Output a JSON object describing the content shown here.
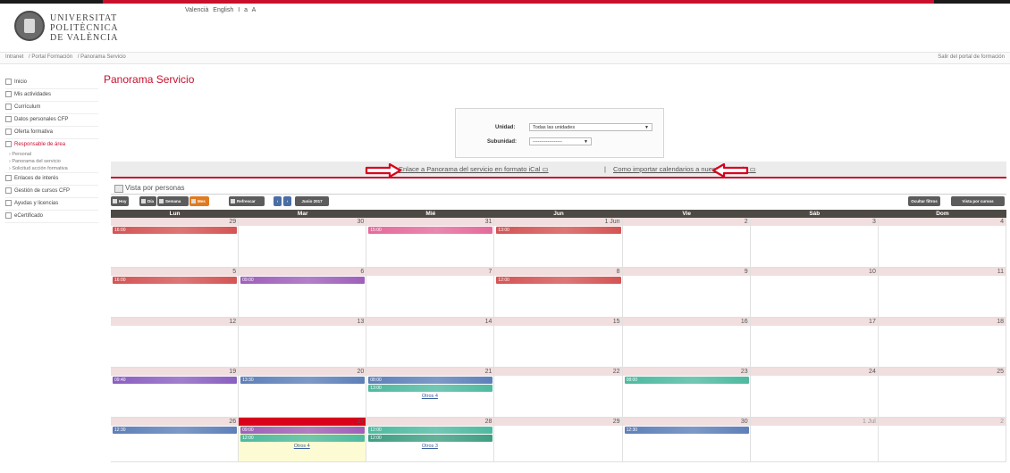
{
  "header": {
    "logo": {
      "line1": "UNIVERSITAT",
      "line2": "POLITÈCNICA",
      "line3": "DE VALÈNCIA"
    },
    "languages": [
      "Valencià",
      "English",
      "I",
      "a",
      "A"
    ]
  },
  "breadcrumb": {
    "items": [
      "Intranet",
      "/ Portal Formación",
      "/ Panorama Servicio"
    ],
    "exit": "Salir del portal de formación"
  },
  "page_title": "Panorama Servicio",
  "sidebar": {
    "items": [
      {
        "label": "Inicio",
        "active": false
      },
      {
        "label": "Mis actividades",
        "active": false
      },
      {
        "label": "Currículum",
        "active": false
      },
      {
        "label": "Datos personales CFP",
        "active": false
      },
      {
        "label": "Oferta formativa",
        "active": false
      },
      {
        "label": "Responsable de área",
        "active": true
      },
      {
        "label": "Enlaces de interés",
        "active": false
      },
      {
        "label": "Gestión de cursos CFP",
        "active": false
      },
      {
        "label": "Ayudas y licencias",
        "active": false
      },
      {
        "label": "eCertificado",
        "active": false
      }
    ],
    "subitems": [
      "› Personal",
      "› Panorama del servicio",
      "› Solicitud acción formativa"
    ]
  },
  "filters": {
    "unidad_label": "Unidad:",
    "unidad_value": "Todas las unidades",
    "subunidad_label": "Subunidad:",
    "subunidad_value": "------------------"
  },
  "links": {
    "ical": "Enlace a Panorama del servicio en formato iCal",
    "separator": "|",
    "import": "Como importar calendarios a nuestra agenda"
  },
  "vista": {
    "title": "Vista por personas"
  },
  "toolbar": {
    "hoy": "Hoy",
    "dia": "Día",
    "semana": "Semana",
    "mes": "Mes",
    "refrescar": "Refrescar",
    "prev": "‹",
    "next": "›",
    "period": "Junio 2017",
    "ocultar": "Ocultar filtros",
    "vista_cursos": "Vista por cursos"
  },
  "calendar": {
    "days": [
      "Lun",
      "Mar",
      "Mié",
      "Jun",
      "Vie",
      "Sáb",
      "Dom"
    ],
    "weeks": [
      [
        "29",
        "30",
        "31",
        "1 Jun",
        "2",
        "3",
        "4"
      ],
      [
        "5",
        "6",
        "7",
        "8",
        "9",
        "10",
        "11"
      ],
      [
        "12",
        "13",
        "14",
        "15",
        "16",
        "17",
        "18"
      ],
      [
        "19",
        "20",
        "21",
        "22",
        "23",
        "24",
        "25"
      ],
      [
        "26",
        "27",
        "28",
        "29",
        "30",
        "1 Jul",
        "2"
      ]
    ],
    "events": [
      {
        "week": 0,
        "day": 0,
        "slot": 0,
        "time": "16:00",
        "color": "#d45454"
      },
      {
        "week": 0,
        "day": 2,
        "slot": 0,
        "time": "15:00",
        "color": "#e46a9a"
      },
      {
        "week": 0,
        "day": 3,
        "slot": 0,
        "time": "13:00",
        "color": "#d45454"
      },
      {
        "week": 1,
        "day": 0,
        "slot": 0,
        "time": "16:00",
        "color": "#d45454"
      },
      {
        "week": 1,
        "day": 1,
        "slot": 0,
        "time": "09:00",
        "color": "#9e5fba"
      },
      {
        "week": 1,
        "day": 3,
        "slot": 0,
        "time": "12:00",
        "color": "#d45454"
      },
      {
        "week": 3,
        "day": 0,
        "slot": 0,
        "time": "09:40",
        "color": "#8a5fc0"
      },
      {
        "week": 3,
        "day": 1,
        "slot": 0,
        "time": "13:30",
        "color": "#5e7fb8"
      },
      {
        "week": 3,
        "day": 2,
        "slot": 0,
        "time": "08:00",
        "color": "#5e7fb8"
      },
      {
        "week": 3,
        "day": 2,
        "slot": 1,
        "time": "13:00",
        "color": "#4fb9a0"
      },
      {
        "week": 3,
        "day": 4,
        "slot": 0,
        "time": "08:00",
        "color": "#4fb9a0"
      },
      {
        "week": 4,
        "day": 0,
        "slot": 0,
        "time": "12:30",
        "color": "#5e7fb8"
      },
      {
        "week": 4,
        "day": 1,
        "slot": 0,
        "time": "09:00",
        "color": "#9e5fba"
      },
      {
        "week": 4,
        "day": 1,
        "slot": 1,
        "time": "12:00",
        "color": "#4fb9a0"
      },
      {
        "week": 4,
        "day": 2,
        "slot": 0,
        "time": "12:00",
        "color": "#4fb9a0"
      },
      {
        "week": 4,
        "day": 2,
        "slot": 1,
        "time": "12:00",
        "color": "#3f9e82"
      },
      {
        "week": 4,
        "day": 4,
        "slot": 0,
        "time": "12:30",
        "color": "#5e7fb8"
      }
    ],
    "more_links": [
      {
        "week": 3,
        "day": 2,
        "label": "Otros 4"
      },
      {
        "week": 4,
        "day": 1,
        "label": "Otros 4"
      },
      {
        "week": 4,
        "day": 2,
        "label": "Otros 3"
      }
    ],
    "today": {
      "week": 4,
      "day": 1
    }
  },
  "colors": {
    "accent": "#c8102e",
    "header_dark": "#4d4944"
  }
}
